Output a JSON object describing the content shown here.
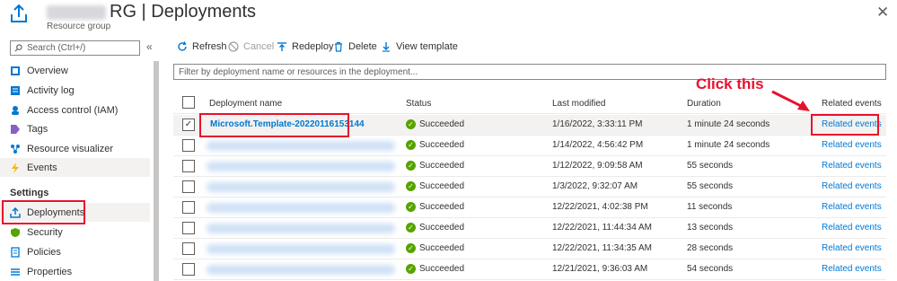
{
  "header": {
    "title": "RG | Deployments",
    "subtitle": "Resource group",
    "more": "···",
    "close": "✕"
  },
  "sidebar": {
    "search_placeholder": "Search (Ctrl+/)",
    "collapse": "«",
    "items": [
      {
        "label": "Overview",
        "icon": "overview-icon"
      },
      {
        "label": "Activity log",
        "icon": "activity-log-icon"
      },
      {
        "label": "Access control (IAM)",
        "icon": "iam-icon"
      },
      {
        "label": "Tags",
        "icon": "tag-icon"
      },
      {
        "label": "Resource visualizer",
        "icon": "visualizer-icon"
      },
      {
        "label": "Events",
        "icon": "events-icon"
      }
    ],
    "section_title": "Settings",
    "settings_items": [
      {
        "label": "Deployments",
        "icon": "deployments-icon"
      },
      {
        "label": "Security",
        "icon": "security-icon"
      },
      {
        "label": "Policies",
        "icon": "policies-icon"
      },
      {
        "label": "Properties",
        "icon": "properties-icon"
      }
    ]
  },
  "toolbar": {
    "refresh": "Refresh",
    "cancel": "Cancel",
    "redeploy": "Redeploy",
    "delete": "Delete",
    "view_template": "View template"
  },
  "filter": {
    "placeholder": "Filter by deployment name or resources in the deployment..."
  },
  "table": {
    "columns": [
      "Deployment name",
      "Status",
      "Last modified",
      "Duration",
      "Related events"
    ],
    "rows": [
      {
        "name": "Microsoft.Template-20220116153144",
        "status": "Succeeded",
        "modified": "1/16/2022, 3:33:11 PM",
        "duration": "1 minute 24 seconds",
        "events": "Related events"
      },
      {
        "name": "",
        "status": "Succeeded",
        "modified": "1/14/2022, 4:56:42 PM",
        "duration": "1 minute 24 seconds",
        "events": "Related events"
      },
      {
        "name": "",
        "status": "Succeeded",
        "modified": "1/12/2022, 9:09:58 AM",
        "duration": "55 seconds",
        "events": "Related events"
      },
      {
        "name": "",
        "status": "Succeeded",
        "modified": "1/3/2022, 9:32:07 AM",
        "duration": "55 seconds",
        "events": "Related events"
      },
      {
        "name": "",
        "status": "Succeeded",
        "modified": "12/22/2021, 4:02:38 PM",
        "duration": "11 seconds",
        "events": "Related events"
      },
      {
        "name": "",
        "status": "Succeeded",
        "modified": "12/22/2021, 11:44:34 AM",
        "duration": "13 seconds",
        "events": "Related events"
      },
      {
        "name": "",
        "status": "Succeeded",
        "modified": "12/22/2021, 11:34:35 AM",
        "duration": "28 seconds",
        "events": "Related events"
      },
      {
        "name": "",
        "status": "Succeeded",
        "modified": "12/21/2021, 9:36:03 AM",
        "duration": "54 seconds",
        "events": "Related events"
      }
    ]
  },
  "annotation": {
    "callout": "Click this",
    "color": "#e8112d"
  },
  "colors": {
    "accent": "#0078d4",
    "success": "#57a300"
  }
}
